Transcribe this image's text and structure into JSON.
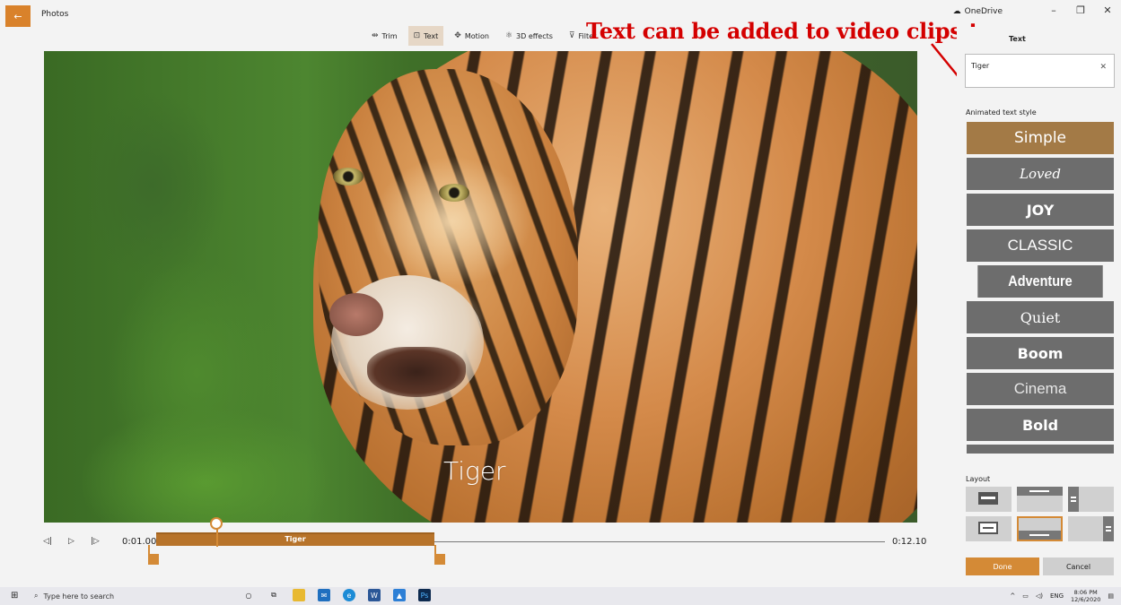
{
  "app": {
    "title": "Photos",
    "onedrive": "OneDrive"
  },
  "window_controls": {
    "minimize": "–",
    "restore": "❐",
    "close": "✕"
  },
  "toolbar": {
    "tools": [
      {
        "label": "Trim",
        "icon": "trim-icon"
      },
      {
        "label": "Text",
        "icon": "text-icon",
        "active": true
      },
      {
        "label": "Motion",
        "icon": "motion-icon"
      },
      {
        "label": "3D effects",
        "icon": "3d-effects-icon"
      },
      {
        "label": "Filter",
        "icon": "filter-icon"
      }
    ]
  },
  "annotation": "Text can be added to video clips too.",
  "preview": {
    "overlay_text": "Tiger"
  },
  "timeline": {
    "start_time": "0:01.00",
    "end_time": "0:12.10",
    "clip_label": "Tiger"
  },
  "panel": {
    "title": "Text",
    "text_value": "Tiger",
    "clear_icon": "close-icon",
    "style_heading": "Animated text style",
    "styles": [
      "Simple",
      "Loved",
      "JOY",
      "CLASSIC",
      "Adventure",
      "Quiet",
      "Boom",
      "Cinema",
      "Bold"
    ],
    "selected_style": "Simple",
    "layout_heading": "Layout",
    "done_label": "Done",
    "cancel_label": "Cancel"
  },
  "taskbar": {
    "search_placeholder": "Type here to search",
    "language": "ENG",
    "time": "8:06 PM",
    "date": "12/6/2020"
  },
  "colors": {
    "accent": "#d48a36",
    "annotation": "#d40000",
    "selected_style": "#a37a46",
    "style_bg": "#6d6d6d"
  }
}
